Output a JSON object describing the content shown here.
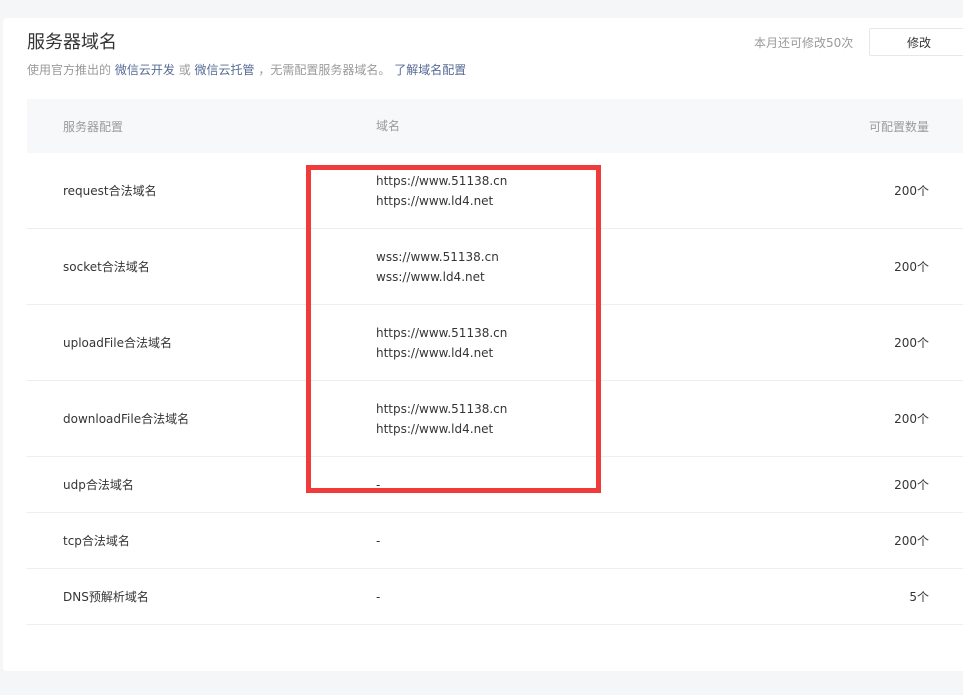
{
  "section": {
    "title": "服务器域名",
    "desc_prefix": "使用官方推出的",
    "link_cloud_dev": "微信云开发",
    "desc_or": "或",
    "link_cloud_hosting": "微信云托管",
    "desc_suffix": "，无需配置服务器域名。",
    "link_learn": "了解域名配置",
    "quota_text": "本月还可修改50次",
    "edit_label": "修改"
  },
  "table": {
    "headers": [
      "服务器配置",
      "域名",
      "可配置数量"
    ],
    "rows": [
      {
        "config": "request合法域名",
        "domains": [
          "https://www.51138.cn",
          "https://www.ld4.net"
        ],
        "count": "200个"
      },
      {
        "config": "socket合法域名",
        "domains": [
          "wss://www.51138.cn",
          "wss://www.ld4.net"
        ],
        "count": "200个"
      },
      {
        "config": "uploadFile合法域名",
        "domains": [
          "https://www.51138.cn",
          "https://www.ld4.net"
        ],
        "count": "200个"
      },
      {
        "config": "downloadFile合法域名",
        "domains": [
          "https://www.51138.cn",
          "https://www.ld4.net"
        ],
        "count": "200个"
      },
      {
        "config": "udp合法域名",
        "domains": [
          "-"
        ],
        "count": "200个"
      },
      {
        "config": "tcp合法域名",
        "domains": [
          "-"
        ],
        "count": "200个"
      },
      {
        "config": "DNS预解析域名",
        "domains": [
          "-"
        ],
        "count": "5个"
      }
    ]
  },
  "colors": {
    "link": "#576b95",
    "highlight": "#f03b3b",
    "header_bg": "#f6f8f9"
  }
}
